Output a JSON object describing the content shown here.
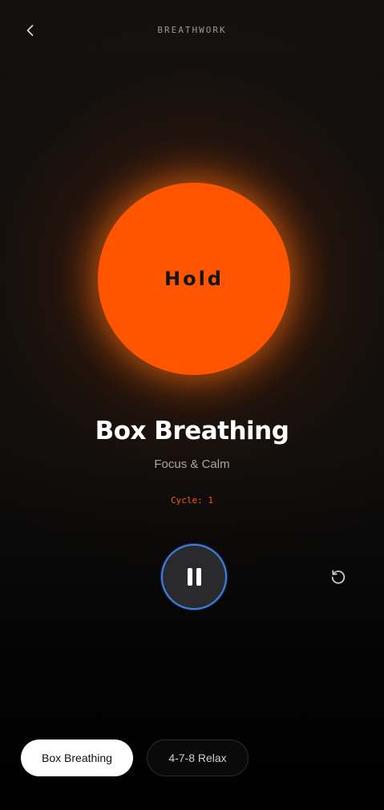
{
  "header": {
    "title": "BREATHWORK",
    "back_icon": "chevron-left-icon"
  },
  "orb": {
    "phase_label": "Hold",
    "color": "#ff5500"
  },
  "exercise": {
    "title": "Box Breathing",
    "subtitle": "Focus & Calm",
    "cycle_label": "Cycle: 1"
  },
  "controls": {
    "pause_icon": "pause-icon",
    "reset_icon": "reset-icon",
    "accent_ring_color": "#3f7fe6"
  },
  "patterns": [
    {
      "label": "Box Breathing",
      "active": true
    },
    {
      "label": "4-7-8 Relax",
      "active": false
    }
  ],
  "colors": {
    "accent": "#ff5500",
    "cycle_text": "#ff5a0a",
    "background": "#0f0e0d"
  }
}
